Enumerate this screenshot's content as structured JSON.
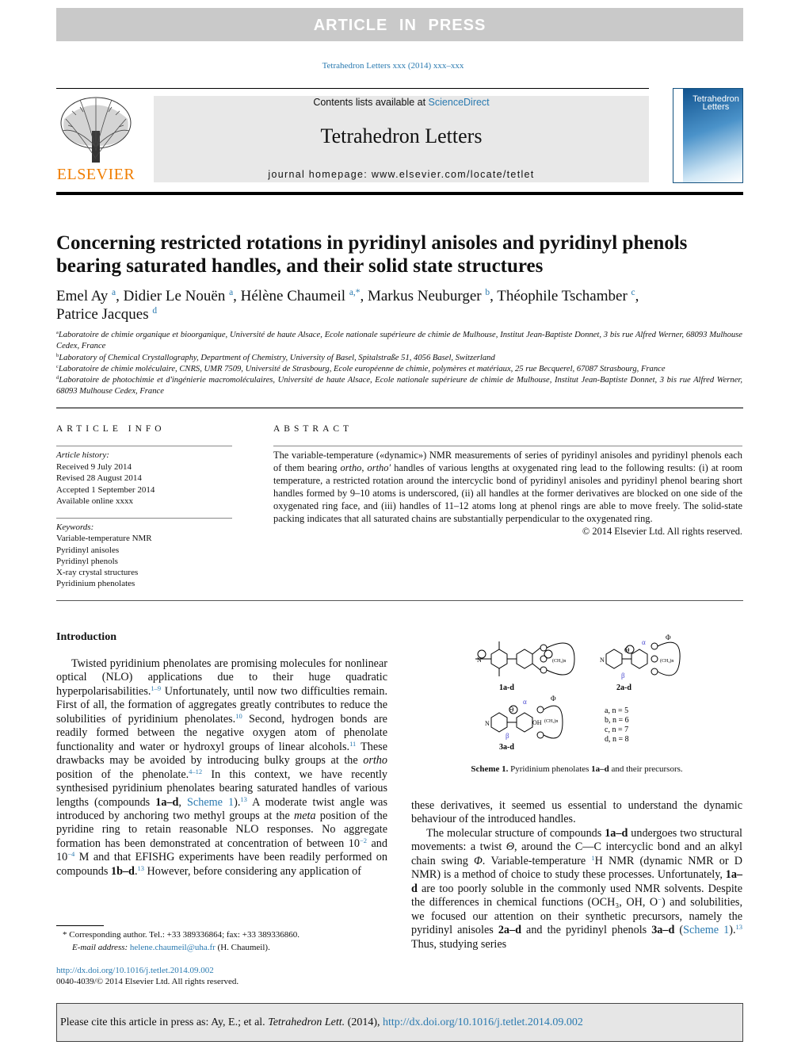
{
  "banner": "ARTICLE IN PRESS",
  "journal_cite": "Tetrahedron Letters xxx (2014) xxx–xxx",
  "header": {
    "contents_prefix": "Contents lists available at ",
    "sciencedirect": "ScienceDirect",
    "journal": "Tetrahedron Letters",
    "homepage_prefix": "journal homepage: ",
    "homepage_url": "www.elsevier.com/locate/tetlet",
    "publisher": "ELSEVIER",
    "cover_title": "Tetrahedron Letters"
  },
  "title": "Concerning restricted rotations in pyridinyl anisoles and pyridinyl phenols bearing saturated handles, and their solid state structures",
  "authors": [
    {
      "name": "Emel Ay",
      "sup": "a"
    },
    {
      "name": "Didier Le Nouën",
      "sup": "a"
    },
    {
      "name": "Hélène Chaumeil",
      "sup": "a,*"
    },
    {
      "name": "Markus Neuburger",
      "sup": "b"
    },
    {
      "name": "Théophile Tschamber",
      "sup": "c"
    },
    {
      "name": "Patrice Jacques",
      "sup": "d"
    }
  ],
  "affiliations": [
    {
      "sup": "a",
      "text": "Laboratoire de chimie organique et bioorganique, Université de haute Alsace, Ecole nationale supérieure de chimie de Mulhouse, Institut Jean-Baptiste Donnet, 3 bis rue Alfred Werner, 68093 Mulhouse Cedex, France"
    },
    {
      "sup": "b",
      "text": "Laboratory of Chemical Crystallography, Department of Chemistry, University of Basel, Spitalstraße 51, 4056 Basel, Switzerland"
    },
    {
      "sup": "c",
      "text": "Laboratoire de chimie moléculaire, CNRS, UMR 7509, Université de Strasbourg, Ecole européenne de chimie, polymères et matériaux, 25 rue Becquerel, 67087 Strasbourg, France"
    },
    {
      "sup": "d",
      "text": "Laboratoire de photochimie et d'ingénierie macromoléculaires, Université de haute Alsace, Ecole nationale supérieure de chimie de Mulhouse, Institut Jean-Baptiste Donnet, 3 bis rue Alfred Werner, 68093 Mulhouse Cedex, France"
    }
  ],
  "article_info": {
    "heading": "ARTICLE INFO",
    "history_label": "Article history:",
    "history": [
      "Received 9 July 2014",
      "Revised 28 August 2014",
      "Accepted 1 September 2014",
      "Available online xxxx"
    ],
    "keywords_label": "Keywords:",
    "keywords": [
      "Variable-temperature NMR",
      "Pyridinyl anisoles",
      "Pyridinyl phenols",
      "X-ray crystal structures",
      "Pyridinium phenolates"
    ]
  },
  "abstract": {
    "heading": "ABSTRACT",
    "segments": [
      {
        "t": "The variable-temperature («dynamic») NMR measurements of series of pyridinyl anisoles and pyridinyl phenols each of them bearing "
      },
      {
        "i": "ortho"
      },
      {
        "t": ", "
      },
      {
        "i": "ortho′"
      },
      {
        "t": " handles of various lengths at oxygenated ring lead to the following results: (i) at room temperature, a restricted rotation around the intercyclic bond of pyridinyl anisoles and pyridinyl phenol bearing short handles formed by 9–10 atoms is underscored, (ii) all handles at the former derivatives are blocked on one side of the oxygenated ring face, and (iii) handles of 11–12 atoms long at phenol rings are able to move freely. The solid-state packing indicates that all saturated chains are substantially perpendicular to the oxygenated ring."
      }
    ],
    "copyright": "© 2014 Elsevier Ltd. All rights reserved."
  },
  "intro": {
    "heading": "Introduction",
    "left": [
      {
        "t": "Twisted pyridinium phenolates are promising molecules for nonlinear optical (NLO) applications due to their huge quadratic hyperpolarisabilities."
      },
      {
        "sup": "1–9"
      },
      {
        "t": " Unfortunately, until now two difficulties remain. First of all, the formation of aggregates greatly contributes to reduce the solubilities of pyridinium phenolates."
      },
      {
        "sup": "10"
      },
      {
        "t": " Second, hydrogen bonds are readily formed between the negative oxygen atom of phenolate functionality and water or hydroxyl groups of linear alcohols."
      },
      {
        "sup": "11"
      },
      {
        "t": " These drawbacks may be avoided by introducing bulky groups at the "
      },
      {
        "i": "ortho"
      },
      {
        "t": " position of the phenolate."
      },
      {
        "sup": "4–12"
      },
      {
        "t": " In this context, we have recently synthesised pyridinium phenolates bearing saturated handles of various lengths (compounds "
      },
      {
        "b": "1a–d"
      },
      {
        "t": ", "
      },
      {
        "link": "Scheme 1"
      },
      {
        "t": ")."
      },
      {
        "sup": "13"
      },
      {
        "t": " A moderate twist angle was introduced by anchoring two methyl groups at the "
      },
      {
        "i": "meta"
      },
      {
        "t": " position of the pyridine ring to retain reasonable NLO responses. No aggregate formation has been demonstrated at concentration of between 10"
      },
      {
        "sup": "−2"
      },
      {
        "t": " and 10"
      },
      {
        "sup": "−4"
      },
      {
        "t": " M and that EFISHG experiments have been readily performed on compounds "
      },
      {
        "b": "1b–d"
      },
      {
        "t": "."
      },
      {
        "sup": "13"
      },
      {
        "t": " However, before considering any application of"
      }
    ],
    "right1": [
      {
        "t": "these derivatives, it seemed us essential to understand the dynamic behaviour of the introduced handles."
      }
    ],
    "right2": [
      {
        "t": "The molecular structure of compounds "
      },
      {
        "b": "1a–d"
      },
      {
        "t": " undergoes two structural movements: a twist "
      },
      {
        "i": "Θ"
      },
      {
        "t": ", around the C—C intercyclic bond and an alkyl chain swing "
      },
      {
        "i": "Φ"
      },
      {
        "t": ". Variable-temperature "
      },
      {
        "sup": "1"
      },
      {
        "t": "H NMR (dynamic NMR or D NMR) is a method of choice to study these processes. Unfortunately, "
      },
      {
        "b": "1a–d"
      },
      {
        "t": " are too poorly soluble in the commonly used NMR solvents. Despite the differences in chemical functions (OCH₃, OH, O"
      },
      {
        "sup": "−"
      },
      {
        "t": ") and solubilities, we focused our attention on their synthetic precursors, namely the pyridinyl anisoles "
      },
      {
        "b": "2a–d"
      },
      {
        "t": " and the pyridinyl phenols "
      },
      {
        "b": "3a–d"
      },
      {
        "t": " ("
      },
      {
        "link": "Scheme 1"
      },
      {
        "t": ")."
      },
      {
        "sup": "13"
      },
      {
        "t": " Thus, studying series"
      }
    ]
  },
  "scheme": {
    "labels": [
      "1a-d",
      "2a-d",
      "3a-d"
    ],
    "variants": [
      "a, n = 5",
      "b, n = 6",
      "c, n = 7",
      "d, n = 8"
    ],
    "chain": "(CH₂)n",
    "greek": {
      "alpha": "α",
      "beta": "β",
      "theta": "Θ",
      "phi": "Φ"
    },
    "caption_bold": "Scheme 1.",
    "caption_text": " Pyridinium phenolates ",
    "caption_cmp": "1a–d",
    "caption_end": " and their precursors."
  },
  "footnote": {
    "mark": "*",
    "text": " Corresponding author. Tel.: +33 389336864; fax: +33 389336860.",
    "email_label": "E-mail address: ",
    "email": "helene.chaumeil@uha.fr",
    "email_name": " (H. Chaumeil)."
  },
  "doi": {
    "url": "http://dx.doi.org/10.1016/j.tetlet.2014.09.002",
    "issn": "0040-4039/© 2014 Elsevier Ltd. All rights reserved."
  },
  "cite_box": {
    "prefix": "Please cite this article in press as: Ay, E.; et al. ",
    "journal": "Tetrahedron Lett.",
    "year": " (2014), ",
    "url": "http://dx.doi.org/10.1016/j.tetlet.2014.09.002"
  }
}
